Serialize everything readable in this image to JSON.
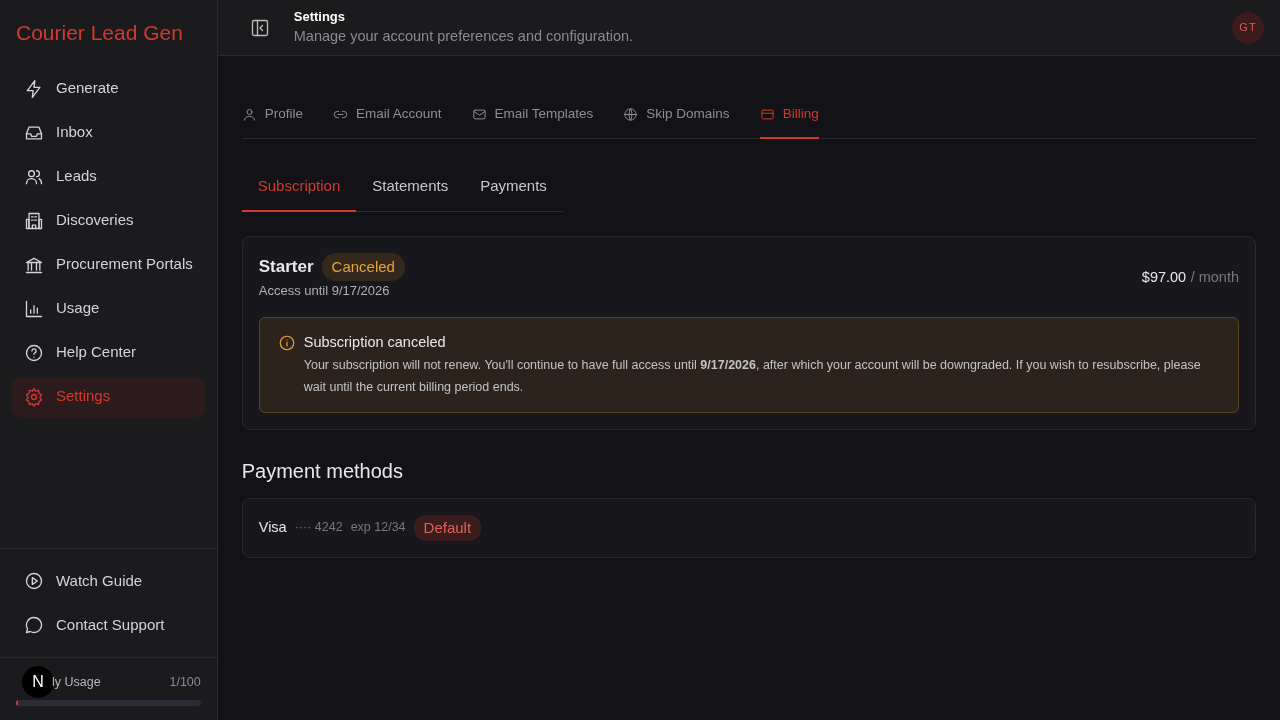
{
  "app": {
    "title": "Courier Lead Gen"
  },
  "sidebar": {
    "items": [
      {
        "kind": "bolt",
        "label": "Generate",
        "selected": false
      },
      {
        "kind": "inbox",
        "label": "Inbox",
        "selected": false
      },
      {
        "kind": "users",
        "label": "Leads",
        "selected": false
      },
      {
        "kind": "building",
        "label": "Discoveries",
        "selected": false
      },
      {
        "kind": "bank",
        "label": "Procurement Portals",
        "selected": false
      },
      {
        "kind": "chart",
        "label": "Usage",
        "selected": false
      },
      {
        "kind": "help",
        "label": "Help Center",
        "selected": false
      },
      {
        "kind": "gear",
        "label": "Settings",
        "selected": true
      }
    ],
    "footer_items": [
      {
        "kind": "play",
        "label": "Watch Guide"
      },
      {
        "kind": "chat",
        "label": "Contact Support"
      }
    ],
    "usage": {
      "badge": "N",
      "label": "ly Usage",
      "reading": "1/100",
      "level": 0.01
    }
  },
  "header": {
    "title": "Settings",
    "subtitle": "Manage your account preferences and configuration.",
    "avatar": "GT"
  },
  "tabs": [
    {
      "kind": "user",
      "label": "Profile",
      "selected": false
    },
    {
      "kind": "link",
      "label": "Email Account",
      "selected": false
    },
    {
      "kind": "mail",
      "label": "Email Templates",
      "selected": false
    },
    {
      "kind": "globe",
      "label": "Skip Domains",
      "selected": false
    },
    {
      "kind": "card",
      "label": "Billing",
      "selected": true
    }
  ],
  "subtabs": [
    {
      "label": "Subscription",
      "selected": true
    },
    {
      "label": "Statements",
      "selected": false
    },
    {
      "label": "Payments",
      "selected": false
    }
  ],
  "subscription": {
    "plan": "Starter",
    "status": "Canceled",
    "access": "Access until 9/17/2026",
    "price": "$97.00",
    "period": "/ month",
    "alert": {
      "title": "Subscription canceled",
      "text": "Your subscription will not renew. You'll continue to have full access until **9/17/2026**, after which your account will be downgraded. If you wish to resubscribe, please wait until the current billing period ends."
    }
  },
  "payment_methods": {
    "title": "Payment methods",
    "items": [
      {
        "brand": "Visa",
        "number": "···· 4242",
        "expiry": "exp 12/34",
        "badge": "Default"
      }
    ]
  }
}
